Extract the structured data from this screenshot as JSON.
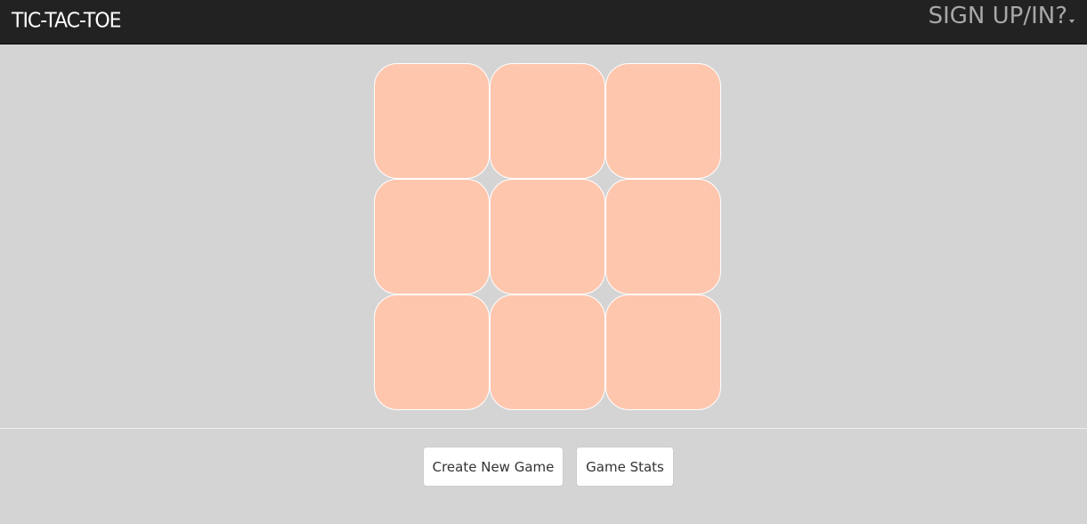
{
  "navbar": {
    "brand": "TIC-TAC-TOE",
    "auth_label": "SIGN UP/IN?"
  },
  "board": {
    "cells": [
      "",
      "",
      "",
      "",
      "",
      "",
      "",
      "",
      ""
    ],
    "cell_color": "#ffc6ae"
  },
  "actions": {
    "create_label": "Create New Game",
    "stats_label": "Game Stats"
  },
  "colors": {
    "navbar_bg": "#222222",
    "page_bg": "#d4d4d4",
    "brand_text": "#ffffff",
    "auth_text": "#a8a8a8"
  }
}
